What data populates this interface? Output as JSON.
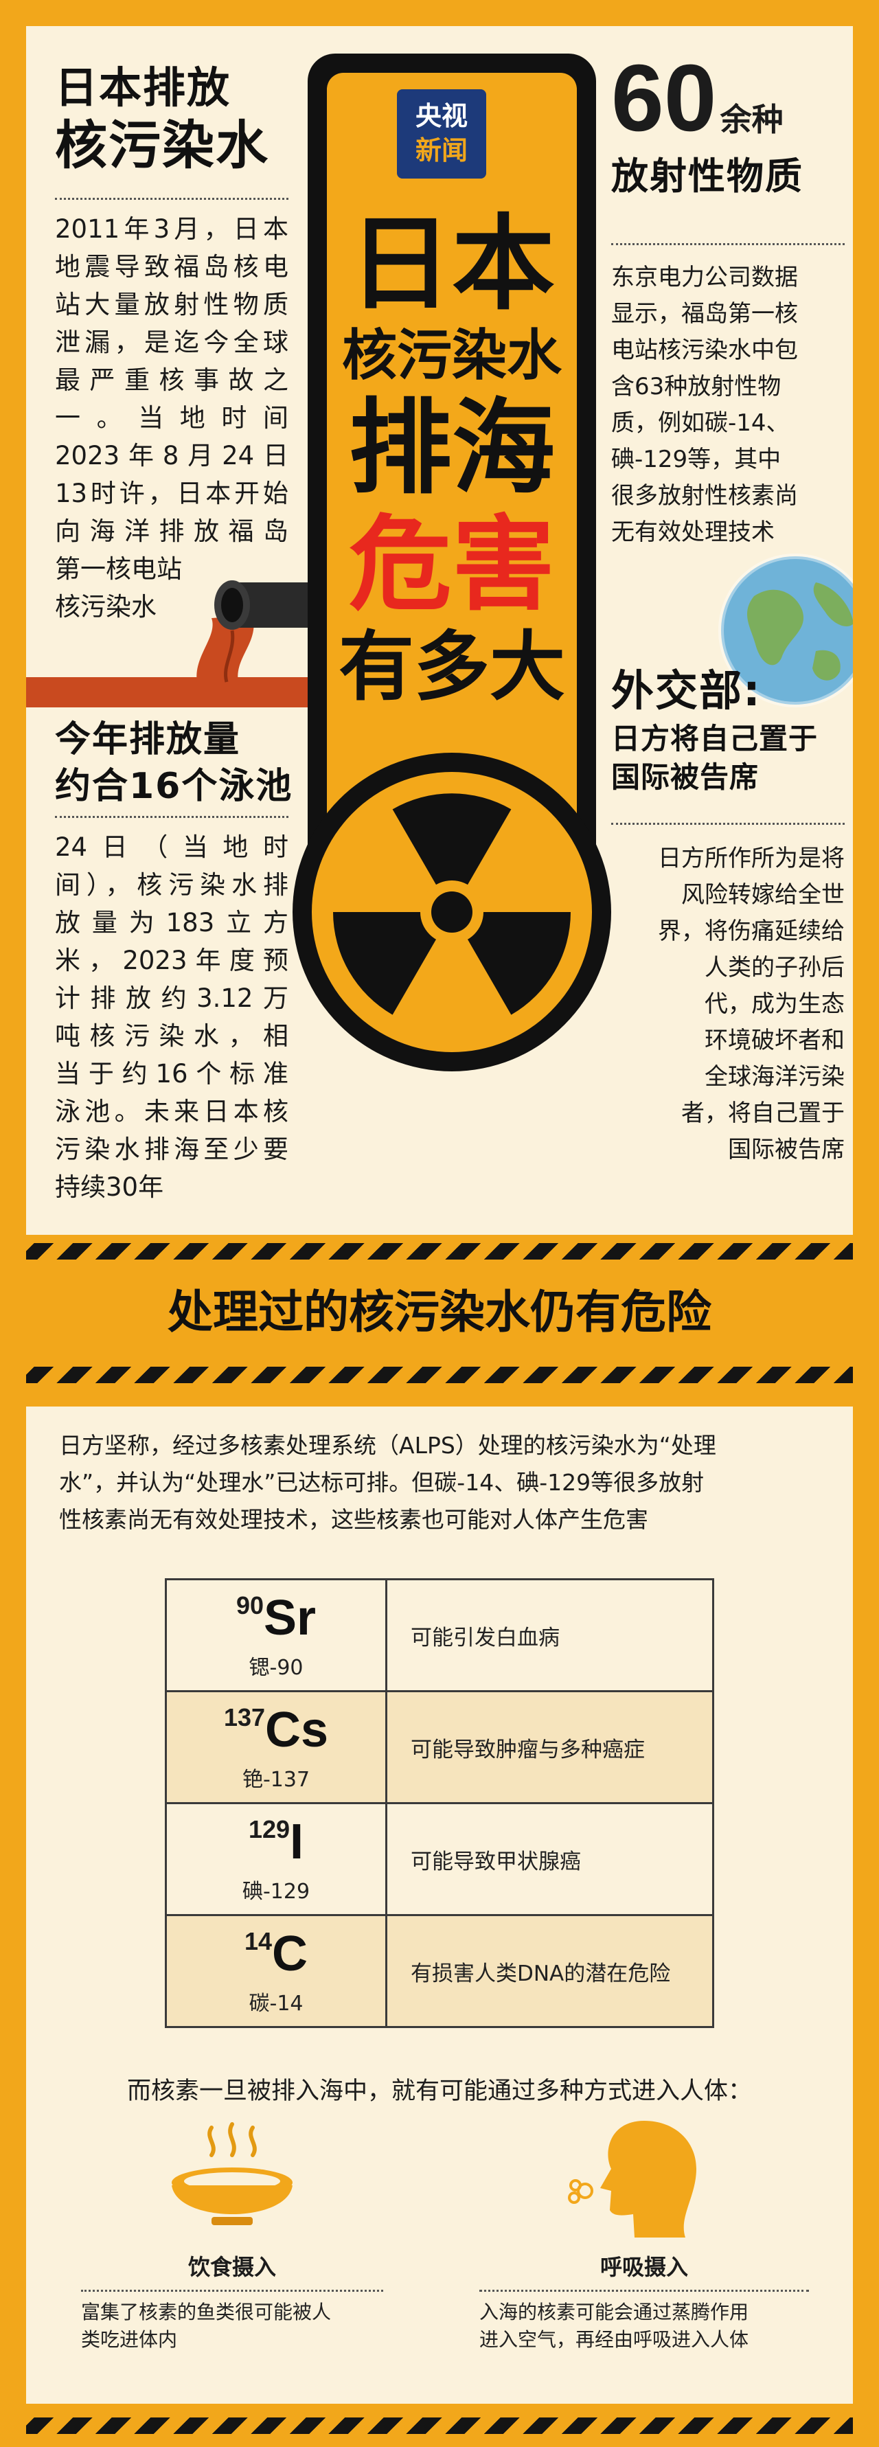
{
  "left": {
    "title_line1": "日本排放",
    "title_line2": "核污染水",
    "body": "2011年3月，日本地震导致福岛核电站大量放射性物质泄漏，是迄今全球最严重核事故之一。当地时间2023年8月24日13时许，日本开始向海洋排放福岛第一核电站核污染水",
    "body_lines": [
      "2011年3月，日本",
      "地震导致福岛核电",
      "站大量放射性物质",
      "泄漏，是迄今全球",
      "最严重核事故之",
      "一。当地时间",
      "2023年8月24日",
      "13时许，日本开始",
      "向海洋排放福岛",
      "第一核电站",
      "核污染水"
    ],
    "pool_title_line1": "今年排放量",
    "pool_title_line2": "约合16个泳池",
    "pool_body_lines": [
      "24日（当地时",
      "间），核污染水排",
      "放量为183立方",
      "米，2023年度预",
      "计排放约3.12万",
      "吨核污染水，相",
      "当于约16个标准",
      "泳池。未来日本核",
      "污染水排海至少要",
      "持续30年"
    ]
  },
  "center": {
    "logo_line1": "央视",
    "logo_line2": "新闻",
    "title_line1": "日本",
    "title_line2": "核污染水",
    "title_line3": "排海",
    "title_line4": "危害",
    "title_line5": "有多大"
  },
  "right": {
    "big_number": "60",
    "big_number_suffix": "余种",
    "subtitle": "放射性物质",
    "body_lines": [
      "东京电力公司数据",
      "显示，福岛第一核",
      "电站核污染水中包",
      "含63种放射性物",
      "质，例如碳-14、",
      "碘-129等，其中",
      "很多放射性核素尚",
      "无有效处理技术"
    ],
    "mfa_title": "外交部:",
    "mfa_subtitle_line1": "日方将自己置于",
    "mfa_subtitle_line2": "国际被告席",
    "mfa_body_lines": [
      "日方所作所为是将",
      "风险转嫁给全世",
      "界，将伤痛延续给",
      "人类的子孙后",
      "代，成为生态",
      "环境破坏者和",
      "全球海洋污染",
      "者，将自己置于",
      "国际被告席"
    ]
  },
  "section2": {
    "title": "处理过的核污染水仍有危险",
    "intro_lines": [
      "日方坚称，经过多核素处理系统（ALPS）处理的核污染水为“处理",
      "水”，并认为“处理水”已达标可排。但碳-14、碘-129等很多放射",
      "性核素尚无有效处理技术，这些核素也可能对人体产生危害"
    ],
    "isotopes": [
      {
        "mass": "90",
        "symbol": "Sr",
        "name": "锶-90",
        "effect": "可能引发白血病"
      },
      {
        "mass": "137",
        "symbol": "Cs",
        "name": "铯-137",
        "effect": "可能导致肿瘤与多种癌症"
      },
      {
        "mass": "129",
        "symbol": "I",
        "name": "碘-129",
        "effect": "可能导致甲状腺癌"
      },
      {
        "mass": "14",
        "symbol": "C",
        "name": "碳-14",
        "effect": "有损害人类DNA的潜在危险"
      }
    ],
    "routes_intro": "而核素一旦被排入海中，就有可能通过多种方式进入人体：",
    "routes": [
      {
        "label": "饮食摄入",
        "icon": "bowl-icon",
        "text_line1": "富集了核素的鱼类很可能被人",
        "text_line2": "类吃进体内"
      },
      {
        "label": "呼吸摄入",
        "icon": "breathing-head-icon",
        "text_line1": "入海的核素可能会通过蒸腾作用",
        "text_line2": "进入空气，再经由呼吸进入人体"
      }
    ]
  },
  "colors": {
    "accent_orange": "#f2a71b",
    "panel_cream": "#fbf2dc",
    "danger_red": "#e8281e",
    "text_dark": "#111111"
  }
}
